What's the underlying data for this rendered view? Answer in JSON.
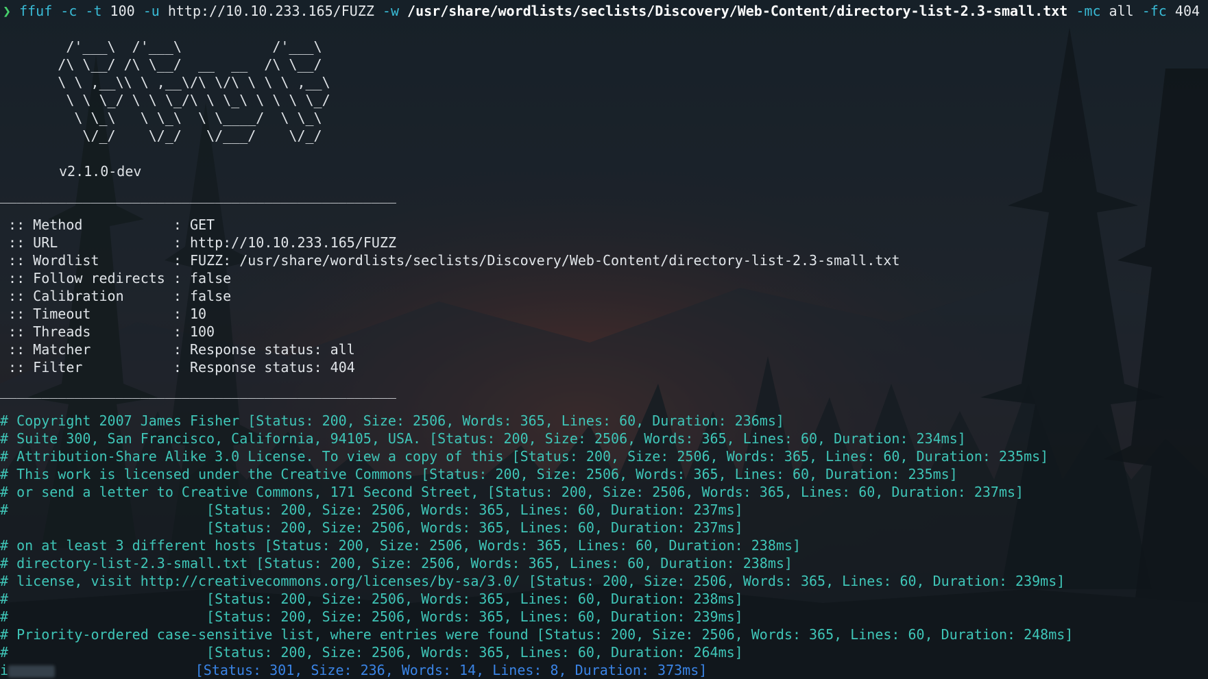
{
  "command": {
    "prompt_glyph": "❯",
    "program": "ffuf",
    "parts": [
      {
        "kind": "flag",
        "text": " -c"
      },
      {
        "kind": "flag",
        "text": " -t"
      },
      {
        "kind": "arg",
        "text": " 100"
      },
      {
        "kind": "flag",
        "text": " -u"
      },
      {
        "kind": "arg",
        "text": " http://10.10.233.165/FUZZ"
      },
      {
        "kind": "flag",
        "text": " -w"
      },
      {
        "kind": "bold",
        "text": " /usr/share/wordlists/seclists/Discovery/Web-Content/directory-list-2.3-small.txt"
      },
      {
        "kind": "flag",
        "text": " -mc"
      },
      {
        "kind": "arg",
        "text": " all"
      },
      {
        "kind": "flag",
        "text": " -fc"
      },
      {
        "kind": "arg",
        "text": " 404"
      }
    ]
  },
  "banner": [
    "        /'___\\  /'___\\           /'___\\",
    "       /\\ \\__/ /\\ \\__/  __  __  /\\ \\__/",
    "       \\ \\ ,__\\\\ \\ ,__\\/\\ \\/\\ \\ \\ \\ ,__\\",
    "        \\ \\ \\_/ \\ \\ \\_/\\ \\ \\_\\ \\ \\ \\ \\_/",
    "         \\ \\_\\   \\ \\_\\  \\ \\____/  \\ \\_\\",
    "          \\/_/    \\/_/   \\/___/    \\/_/"
  ],
  "version": "v2.1.0-dev",
  "divider": "________________________________________________",
  "config": [
    {
      "key": " :: Method           ",
      "value": ": GET"
    },
    {
      "key": " :: URL              ",
      "value": ": http://10.10.233.165/FUZZ"
    },
    {
      "key": " :: Wordlist         ",
      "value": ": FUZZ: /usr/share/wordlists/seclists/Discovery/Web-Content/directory-list-2.3-small.txt"
    },
    {
      "key": " :: Follow redirects ",
      "value": ": false"
    },
    {
      "key": " :: Calibration      ",
      "value": ": false"
    },
    {
      "key": " :: Timeout          ",
      "value": ": 10"
    },
    {
      "key": " :: Threads          ",
      "value": ": 100"
    },
    {
      "key": " :: Matcher          ",
      "value": ": Response status: all"
    },
    {
      "key": " :: Filter           ",
      "value": ": Response status: 404"
    }
  ],
  "results": [
    {
      "status": "200",
      "text": "# Copyright 2007 James Fisher [Status: 200, Size: 2506, Words: 365, Lines: 60, Duration: 236ms]"
    },
    {
      "status": "200",
      "text": "# Suite 300, San Francisco, California, 94105, USA. [Status: 200, Size: 2506, Words: 365, Lines: 60, Duration: 234ms]"
    },
    {
      "status": "200",
      "text": "# Attribution-Share Alike 3.0 License. To view a copy of this [Status: 200, Size: 2506, Words: 365, Lines: 60, Duration: 235ms]"
    },
    {
      "status": "200",
      "text": "# This work is licensed under the Creative Commons [Status: 200, Size: 2506, Words: 365, Lines: 60, Duration: 235ms]"
    },
    {
      "status": "200",
      "text": "# or send a letter to Creative Commons, 171 Second Street, [Status: 200, Size: 2506, Words: 365, Lines: 60, Duration: 237ms]"
    },
    {
      "status": "200",
      "text": "#                        [Status: 200, Size: 2506, Words: 365, Lines: 60, Duration: 237ms]"
    },
    {
      "status": "200",
      "text": "                         [Status: 200, Size: 2506, Words: 365, Lines: 60, Duration: 237ms]"
    },
    {
      "status": "200",
      "text": "# on at least 3 different hosts [Status: 200, Size: 2506, Words: 365, Lines: 60, Duration: 238ms]"
    },
    {
      "status": "200",
      "text": "# directory-list-2.3-small.txt [Status: 200, Size: 2506, Words: 365, Lines: 60, Duration: 238ms]"
    },
    {
      "status": "200",
      "text": "# license, visit http://creativecommons.org/licenses/by-sa/3.0/ [Status: 200, Size: 2506, Words: 365, Lines: 60, Duration: 239ms]"
    },
    {
      "status": "200",
      "text": "#                        [Status: 200, Size: 2506, Words: 365, Lines: 60, Duration: 238ms]"
    },
    {
      "status": "200",
      "text": "#                        [Status: 200, Size: 2506, Words: 365, Lines: 60, Duration: 239ms]"
    },
    {
      "status": "200",
      "text": "# Priority-ordered case-sensitive list, where entries were found [Status: 200, Size: 2506, Words: 365, Lines: 60, Duration: 248ms]"
    },
    {
      "status": "200",
      "text": "#                        [Status: 200, Size: 2506, Words: 365, Lines: 60, Duration: 264ms]"
    },
    {
      "status": "301",
      "prefix": "i",
      "redacted": true,
      "text": "                 [Status: 301, Size: 236, Words: 14, Lines: 8, Duration: 373ms]"
    }
  ],
  "colors": {
    "prompt": "#47d16c",
    "flag": "#39bbd6",
    "status_200": "#3fc6b8",
    "status_301": "#3a84e6"
  }
}
